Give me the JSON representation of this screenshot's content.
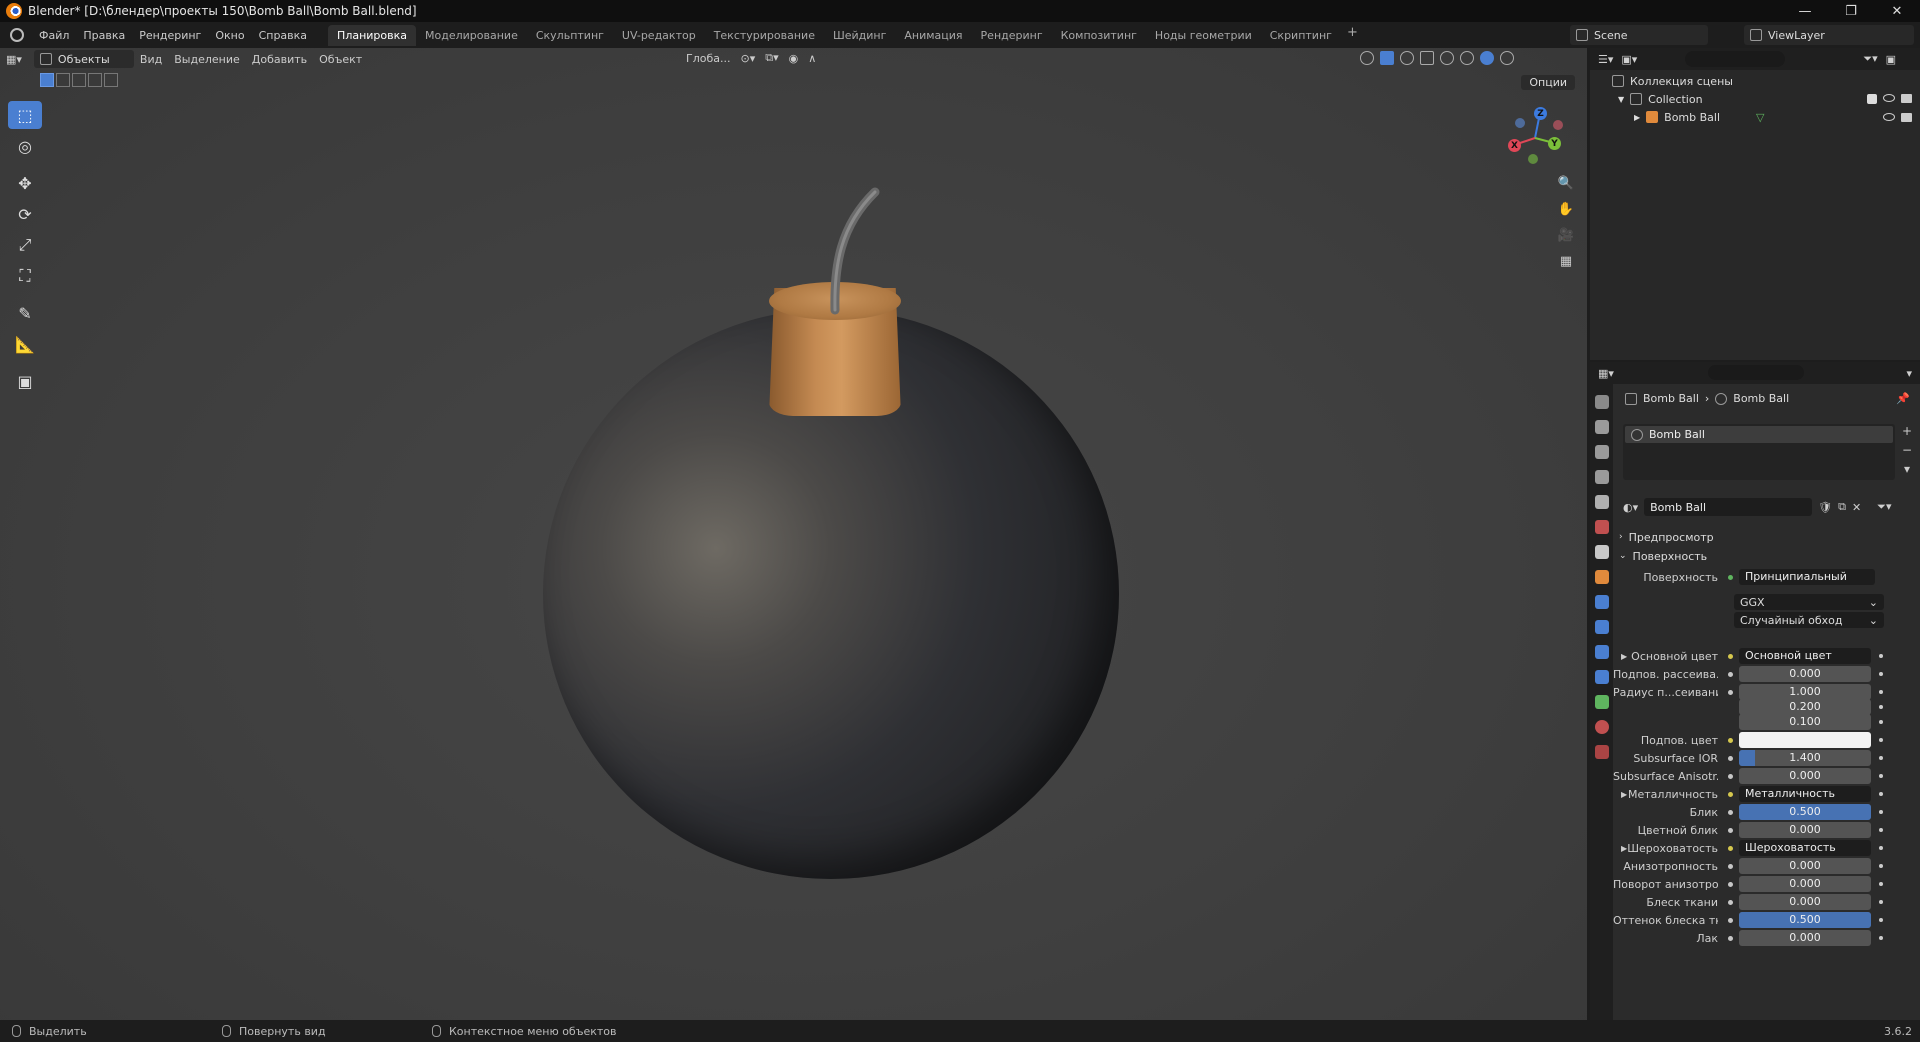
{
  "window": {
    "title": "Blender* [D:\\блендер\\проекты 150\\Bomb Ball\\Bomb Ball.blend]",
    "min": "—",
    "max": "❐",
    "close": "✕"
  },
  "menu": [
    "Файл",
    "Правка",
    "Рендеринг",
    "Окно",
    "Справка"
  ],
  "workspaces": [
    "Планировка",
    "Моделирование",
    "Скульптинг",
    "UV-редактор",
    "Текстурирование",
    "Шейдинг",
    "Анимация",
    "Рендеринг",
    "Композитинг",
    "Ноды геометрии",
    "Скриптинг"
  ],
  "workspace_plus": "+",
  "scene": "Scene",
  "view_layer": "ViewLayer",
  "viewport": {
    "mode": "Объекты",
    "menus": [
      "Вид",
      "Выделение",
      "Добавить",
      "Объект"
    ],
    "orientation": "Глоба...",
    "options": "Опции"
  },
  "gizmo": {
    "z": "Z",
    "x": "X",
    "y": "Y"
  },
  "tools": [
    "⬚",
    "◎",
    "✥",
    "⟳",
    "⤢",
    "⛶",
    "✎",
    "📐",
    "▣"
  ],
  "outliner": {
    "scene_collection": "Коллекция сцены",
    "collection": "Collection",
    "object": "Bomb Ball"
  },
  "properties": {
    "breadcrumb_object": "Bomb Ball",
    "breadcrumb_sep": "›",
    "breadcrumb_material": "Bomb Ball",
    "slot": "Bomb Ball",
    "material_name": "Bomb Ball",
    "preview_panel": "Предпросмотр",
    "surface_panel": "Поверхность",
    "surface_label": "Поверхность",
    "surface_value": "Принципиальный BSDF",
    "distribution": "GGX",
    "subsurface_method": "Случайный обход",
    "rows": [
      {
        "label": "Основной цвет",
        "value": "Основной цвет",
        "kind": "link"
      },
      {
        "label": "Подпов. рассеива...",
        "value": "0.000",
        "kind": "num"
      },
      {
        "label": "Радиус п...сеивания",
        "value": "1.000",
        "kind": "num"
      },
      {
        "label": "",
        "value": "0.200",
        "kind": "num"
      },
      {
        "label": "",
        "value": "0.100",
        "kind": "num"
      },
      {
        "label": "Подпов. цвет",
        "value": "",
        "kind": "color"
      },
      {
        "label": "Subsurface IOR",
        "value": "1.400",
        "kind": "num"
      },
      {
        "label": "Subsurface Anisotr...",
        "value": "0.000",
        "kind": "num"
      },
      {
        "label": "Металличность",
        "value": "Металличность",
        "kind": "link"
      },
      {
        "label": "Блик",
        "value": "0.500",
        "kind": "num"
      },
      {
        "label": "Цветной блик",
        "value": "0.000",
        "kind": "num"
      },
      {
        "label": "Шероховатость",
        "value": "Шероховатость",
        "kind": "link"
      },
      {
        "label": "Анизотропность",
        "value": "0.000",
        "kind": "num"
      },
      {
        "label": "Поворот анизотро...",
        "value": "0.000",
        "kind": "num"
      },
      {
        "label": "Блеск ткани",
        "value": "0.000",
        "kind": "num"
      },
      {
        "label": "Оттенок блеска тк...",
        "value": "0.500",
        "kind": "num"
      },
      {
        "label": "Лак",
        "value": "0.000",
        "kind": "num"
      }
    ]
  },
  "status": {
    "select": "Выделить",
    "rotate": "Повернуть вид",
    "context": "Контекстное меню объектов",
    "version": "3.6.2"
  }
}
